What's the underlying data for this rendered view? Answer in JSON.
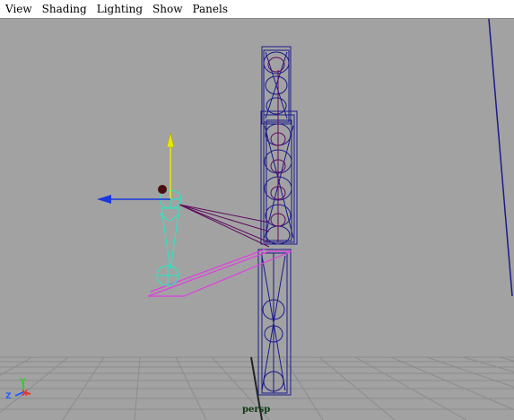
{
  "menu": {
    "items": [
      {
        "label": "View"
      },
      {
        "label": "Shading"
      },
      {
        "label": "Lighting"
      },
      {
        "label": "Show"
      },
      {
        "label": "Panels"
      }
    ]
  },
  "viewport": {
    "camera_label": "persp",
    "colors": {
      "background": "#a2a2a2",
      "grid": "#8e8e8e",
      "mesh_wire": "#1a1a8c",
      "joint_wire": "#5e0a5e",
      "selected_wire": "#33e0c0",
      "highlight": "#e040e0",
      "move_y": "#e6e60a",
      "move_x": "#1b37e0"
    },
    "axis_gizmo": {
      "x_label": "X",
      "y_label": "Y",
      "z_label": "Z"
    }
  }
}
